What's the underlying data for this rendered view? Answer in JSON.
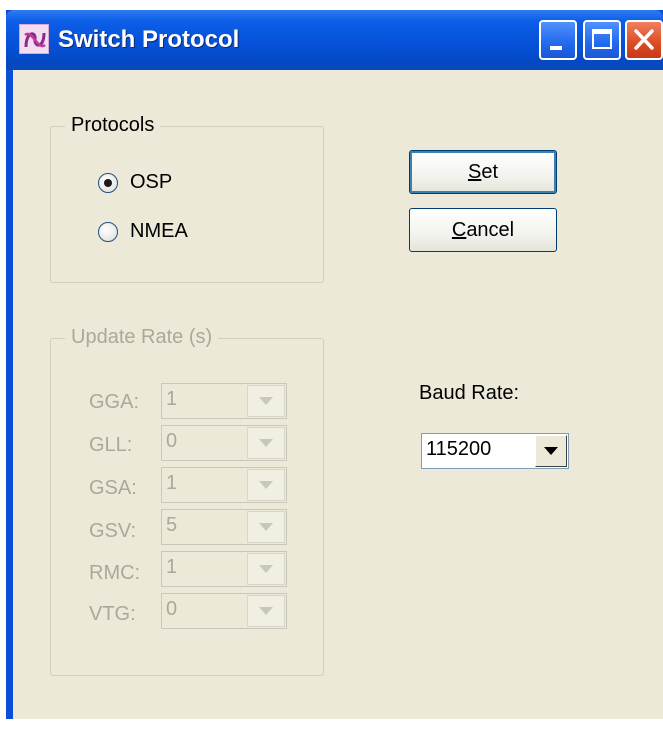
{
  "window": {
    "title": "Switch Protocol",
    "icon": "app-logo-icon",
    "controls": [
      "minimize-icon",
      "maximize-icon",
      "close-icon"
    ],
    "accent_color": "#0552d9",
    "close_color": "#db4b22",
    "client_color": "#ece9d8"
  },
  "protocols": {
    "label": "Protocols",
    "options": [
      {
        "label": "OSP",
        "checked": true
      },
      {
        "label": "NMEA",
        "checked": false
      }
    ]
  },
  "buttons": {
    "set": {
      "mnemonic": "S",
      "rest": "et"
    },
    "cancel": {
      "mnemonic": "C",
      "rest": "ancel"
    }
  },
  "update_rate": {
    "label": "Update Rate (s)",
    "disabled": true,
    "rows": [
      {
        "label": "GGA:",
        "value": "1"
      },
      {
        "label": "GLL:",
        "value": "0"
      },
      {
        "label": "GSA:",
        "value": "1"
      },
      {
        "label": "GSV:",
        "value": "5"
      },
      {
        "label": "RMC:",
        "value": "1"
      },
      {
        "label": "VTG:",
        "value": "0"
      }
    ]
  },
  "baud_rate": {
    "label": "Baud Rate:",
    "value": "115200"
  }
}
